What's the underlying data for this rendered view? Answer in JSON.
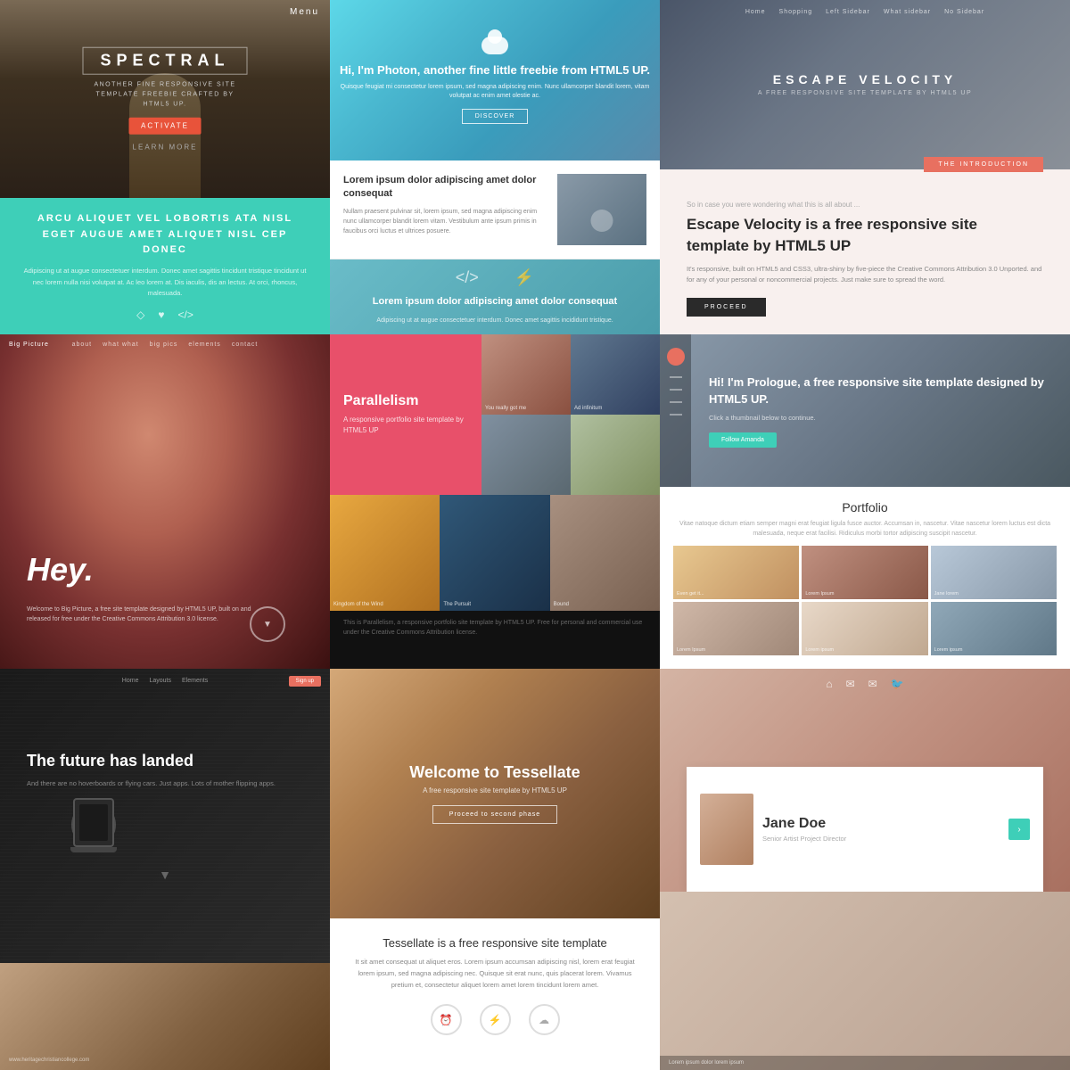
{
  "spectral": {
    "menu_label": "Menu",
    "title": "SPECTRAL",
    "subtitle": "ANOTHER FINE RESPONSIVE\nSITE TEMPLATE FREEBIE\nCRAFTED BY HTML5 UP.",
    "activate_btn": "ACTIVATE",
    "learn_more": "LEARN MORE",
    "heading": "ARCU ALIQUET VEL LOBORTIS ATA NISL\nEGET AUGUE AMET ALIQUET NISL CEP DONEC",
    "body_text": "Adipiscing ut at augue consectetuer interdum. Donec amet sagittis tincidunt tristique tincidunt ut nec lorem nulla nisi volutpat at. Ac leo lorem at. Dis iaculis, dis an lectus. At orci, rhoncus, malesuada."
  },
  "photon": {
    "hero_title": "Hi, I'm Photon, another fine\nlittle freebie from HTML5 UP.",
    "hero_sub": "Quisque feugiat mi consectetur lorem ipsum, sed magna adipiscing enim. Nunc ullamcorper blandit lorem, vitam volutpat ac enim amet olestie ac.",
    "hero_btn": "DISCOVER",
    "section1_title": "Lorem ipsum dolor adipiscing\namet dolor consequat",
    "section1_body": "Nullam praesent pulvinar sit, lorem ipsum, sed magna adipiscing enim nunc ullamcorper blandit lorem vitam. Vestibulum ante ipsum primis in faucibus orci luctus et ultrices posuere.",
    "section2_title": "Lorem ipsum dolor adipiscing\namet dolor consequat",
    "section2_body": "Adipiscing ut at augue consectetuer interdum. Donec amet sagittis incididunt tristique."
  },
  "escape": {
    "nav_items": [
      "Home",
      "Shopping",
      "Left Sidebar",
      "What sidebar",
      "No Sidebar"
    ],
    "title": "ESCAPE VELOCITY",
    "subtitle": "A FREE RESPONSIVE SITE TEMPLATE BY HTML5 UP",
    "intro_tab": "THE INTRODUCTION",
    "so_text": "So in case you were wondering what this is all about ...",
    "main_title": "Escape Velocity is a free responsive site template by HTML5 UP",
    "desc_text": "It's responsive, built on HTML5 and CSS3, ultra-shiny by five-piece the Creative Commons Attribution 3.0 Unported. and for any of your personal or noncommercial projects. Just make sure to spread the word.",
    "proceed_btn": "PROCEED"
  },
  "bigpicture": {
    "label": "Big Picture",
    "nav_items": [
      "about",
      "what what",
      "big pics",
      "elements",
      "contact"
    ],
    "hey_text": "Hey.",
    "sub_text": "Welcome to Big Picture, a free site template designed by HTML5 UP, built on and released for free under the Creative Commons Attribution 3.0 license."
  },
  "parallelism": {
    "title": "Parallelism",
    "subtitle": "A responsive portfolio site\ntemplate by HTML5 UP",
    "photo_labels": [
      "You really got me",
      "Ad infinitum",
      "Kingdom of the Wind",
      "The Pursuit",
      "Bound"
    ],
    "footer_text": "This is Parallelism, a responsive portfolio site template by HTML5 UP. Free for personal and commercial use under the Creative Commons Attribution license."
  },
  "prologue_hero": {
    "title": "Hi! I'm Prologue, a free responsive\nsite template designed by HTML5 UP.",
    "sub_text": "Click a thumbnail below to continue.",
    "btn_label": "Follow Amanda",
    "portfolio_title": "Portfolio",
    "portfolio_sub": "Vitae natoque dictum etiam semper magni erat feugiat ligula fusce auctor. Accumsan in, nascetur. Vitae nascetur lorem luctus est dicta malesuada, neque erat facilisi. Ridiculus morbi tortor adipiscing suscipit nascetur.",
    "photo_labels": [
      "Even get it...",
      "Lorem Ipsum",
      "Jane lorem",
      "Lorem Ipsum",
      "Lorem ipsum",
      "Lorem ipsum"
    ]
  },
  "landed": {
    "nav_items": [
      "Home",
      "Layouts",
      "Elements"
    ],
    "nav_btn": "Sign up",
    "main_title": "The future has landed",
    "sub_text": "And there are no hoverboards or flying cars. Just apps. Lots of mother flipping apps.",
    "bottom_url": "www.heritagechristiancollege.com"
  },
  "tessellate": {
    "hero_title": "Welcome to Tessellate",
    "hero_sub": "A free responsive site template by HTML5 UP",
    "hero_btn": "Proceed to second phase",
    "content_title": "Tessellate is a free responsive site template",
    "content_body": "It sit amet consequat ut aliquet eros. Lorem ipsum accumsan adipiscing nisl, lorem erat feugiat lorem ipsum, sed magna adipiscing nec. Quisque sit erat nunc, quis placerat lorem. Vivamus pretium et, consectetur aliquet lorem amet lorem tincidunt lorem amet."
  },
  "prologue_card": {
    "nav_icons": [
      "home",
      "mail",
      "mail2",
      "twitter"
    ],
    "name": "Jane Doe",
    "role": "Senior Artist Project Director",
    "bottom_text": "Lorem ipsum dolor lorem ipsum"
  }
}
